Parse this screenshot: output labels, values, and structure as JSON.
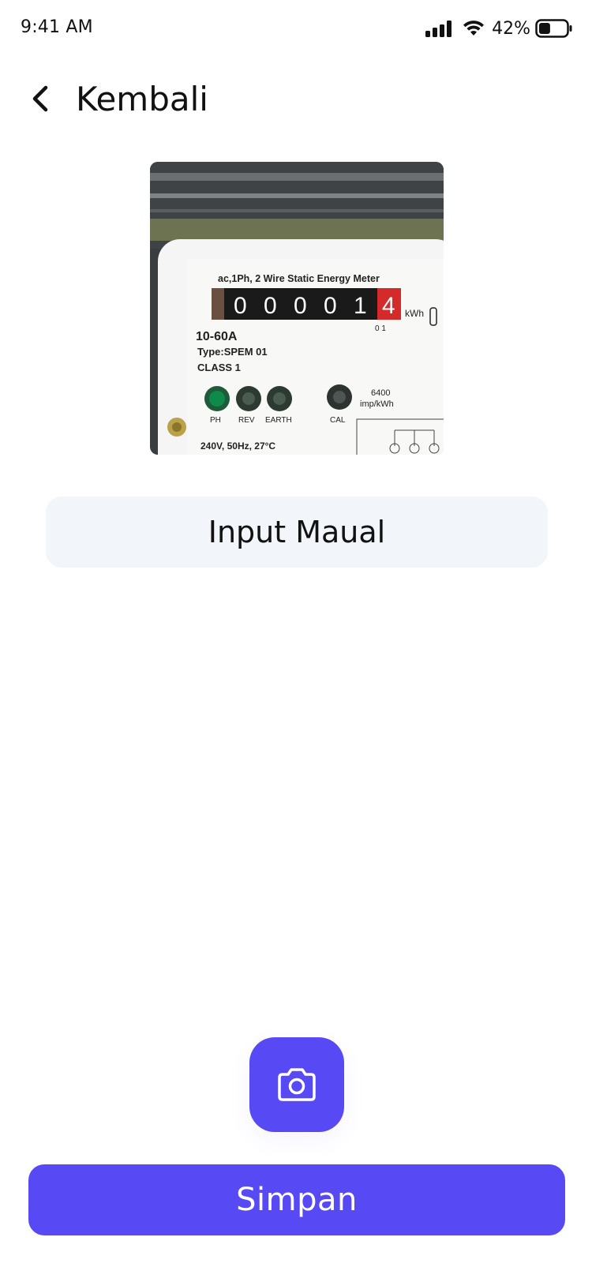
{
  "status_bar": {
    "time": "9:41 AM",
    "battery_percent": "42%",
    "battery_level": 0.42,
    "icons": [
      "signal-icon",
      "wifi-icon",
      "battery-icon"
    ]
  },
  "header": {
    "back_label": "Kembali",
    "back_icon": "chevron-left-icon"
  },
  "meter_photo": {
    "title_line": "ac,1Ph, 2 Wire Static Energy Meter",
    "digits": [
      "0",
      "0",
      "0",
      "0",
      "1",
      "4"
    ],
    "digit_unit": "kWh",
    "decimal_marker": "0 1",
    "rating": "10-60A",
    "type": "Type:SPEM 01",
    "class": "CLASS 1",
    "indicator_labels": [
      "PH",
      "REV",
      "EARTH",
      "CAL"
    ],
    "imp_value": "6400",
    "imp_unit": "imp/kWh",
    "spec": "240V, 50Hz, 27°C"
  },
  "manual_input": {
    "label": "Input Maual"
  },
  "camera": {
    "icon": "camera-icon"
  },
  "save": {
    "label": "Simpan"
  },
  "colors": {
    "accent": "#574af5",
    "manual_bg": "#f2f5f9",
    "text": "#111111"
  }
}
